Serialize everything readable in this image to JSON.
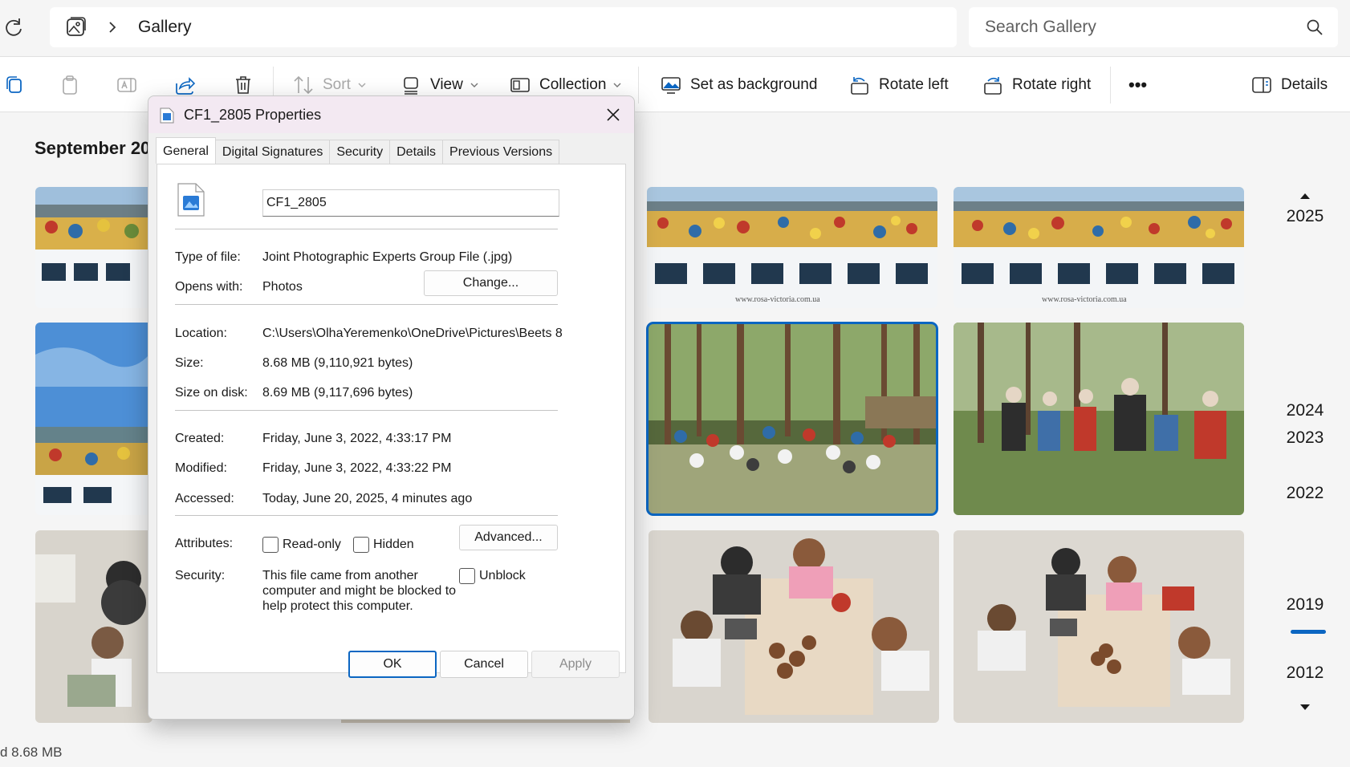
{
  "address": {
    "crumb": "Gallery"
  },
  "search": {
    "placeholder": "Search Gallery"
  },
  "toolbar": {
    "sort": "Sort",
    "view": "View",
    "collection": "Collection",
    "set_background": "Set as background",
    "rotate_left": "Rotate left",
    "rotate_right": "Rotate right",
    "more": "•••",
    "details": "Details"
  },
  "content": {
    "section_title": "September 201"
  },
  "timeline": {
    "years": [
      "2025",
      "2024",
      "2023",
      "2022",
      "2019",
      "2012"
    ],
    "current_year": "2019"
  },
  "status": {
    "text": "d  8.68 MB"
  },
  "dialog": {
    "title": "CF1_2805 Properties",
    "tabs": [
      "General",
      "Digital Signatures",
      "Security",
      "Details",
      "Previous Versions"
    ],
    "active_tab": "General",
    "file_name": "CF1_2805",
    "type_label": "Type of file:",
    "type_value": "Joint Photographic Experts Group File (.jpg)",
    "opens_label": "Opens with:",
    "opens_value": "Photos",
    "change_button": "Change...",
    "location_label": "Location:",
    "location_value": "C:\\Users\\OlhaYeremenko\\OneDrive\\Pictures\\Beets 8",
    "size_label": "Size:",
    "size_value": "8.68 MB (9,110,921 bytes)",
    "size_disk_label": "Size on disk:",
    "size_disk_value": "8.69 MB (9,117,696 bytes)",
    "created_label": "Created:",
    "created_value": "Friday, June 3, 2022, 4:33:17 PM",
    "modified_label": "Modified:",
    "modified_value": "Friday, June 3, 2022, 4:33:22 PM",
    "accessed_label": "Accessed:",
    "accessed_value": "Today, June 20, 2025, 4 minutes ago",
    "attributes_label": "Attributes:",
    "readonly_label": "Read-only",
    "hidden_label": "Hidden",
    "advanced_button": "Advanced...",
    "security_label": "Security:",
    "security_text": "This file came from another computer and might be blocked to help protect this computer.",
    "unblock_label": "Unblock",
    "ok_button": "OK",
    "cancel_button": "Cancel",
    "apply_button": "Apply"
  },
  "photos": {
    "watermark": "www.rosa-victoria.com.ua"
  },
  "colors": {
    "accent": "#0b66c2",
    "title_bar": "#f3e9f2"
  }
}
